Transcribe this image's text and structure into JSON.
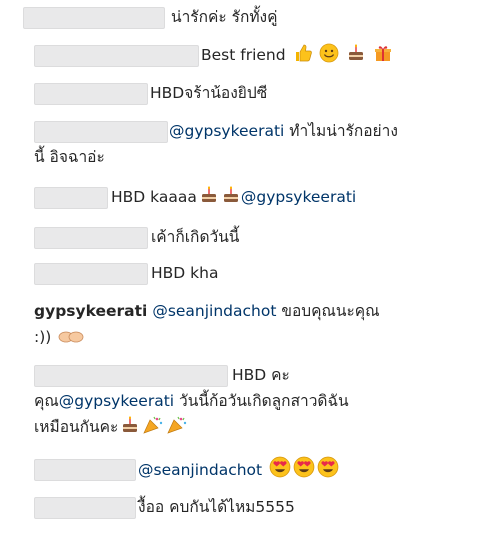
{
  "comments": [
    {
      "text": "น่ารักค่ะ รักทั้งคู่"
    },
    {
      "text": "Best friend",
      "emojis": [
        "thumbs-up",
        "smile",
        "cake",
        "gift"
      ]
    },
    {
      "text": "HBDจร้าน้องยิปซี"
    },
    {
      "mention": "@gypsykeerati",
      "text": "ทำไมน่ารักอย่าง",
      "line2": "นี้ อิจฉาอ่ะ"
    },
    {
      "text": "HBD kaaaa",
      "mention": "@gypsykeerati",
      "emojis": [
        "cake",
        "cake"
      ]
    },
    {
      "text": "เค้าก็เกิดวันนี้"
    },
    {
      "text": "HBD kha"
    },
    {
      "username": "gypsykeerati",
      "mention": "@seanjindachot",
      "text": "ขอบคุณนะคุณ",
      "line2": ":))",
      "emojis": [
        "hands"
      ]
    },
    {
      "text": "HBD คะ",
      "line2_prefix": "คุณ",
      "mention": "@gypsykeerati",
      "line2_text": "วันนี้ก้อวันเกิดลูกสาวดิฉัน",
      "line3": "เหมือนกันคะ",
      "emojis": [
        "cake",
        "party-popper",
        "party-popper"
      ]
    },
    {
      "mention": "@seanjindachot",
      "emojis": [
        "heart-eyes",
        "heart-eyes",
        "heart-eyes"
      ]
    },
    {
      "text": "งื้ออ คบกันได้ไหม5555"
    }
  ]
}
